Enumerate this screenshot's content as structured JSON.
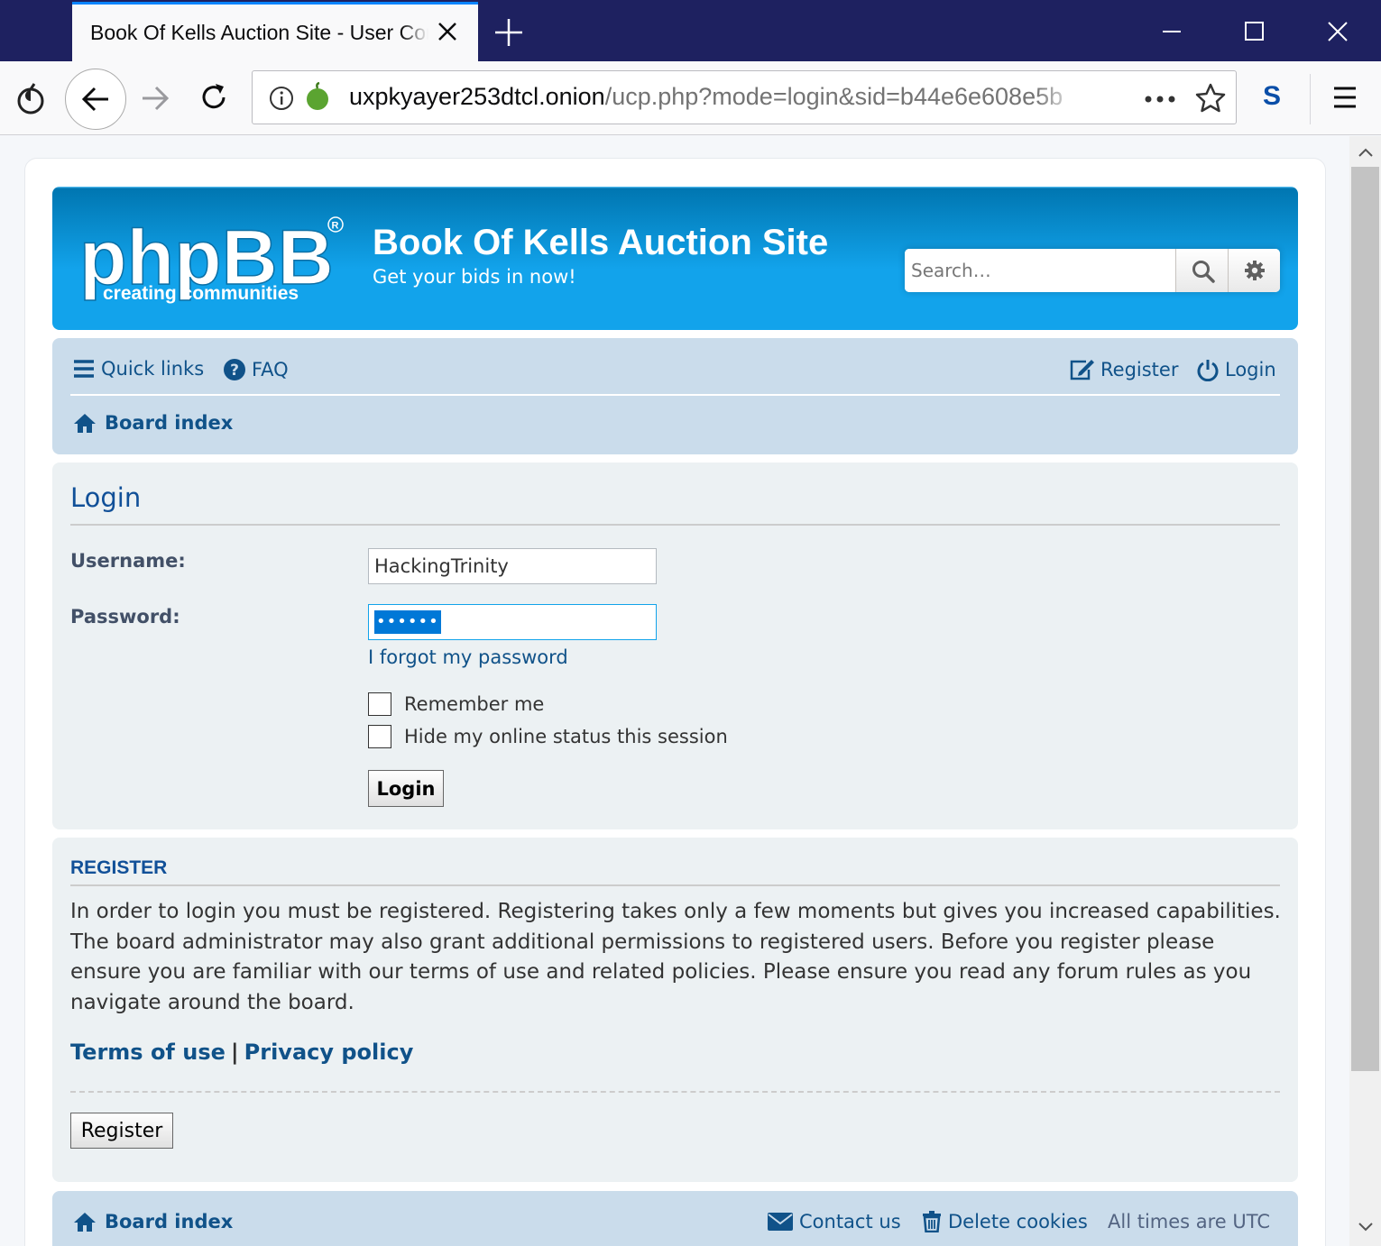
{
  "browser": {
    "tab_title": "Book Of Kells Auction Site - User Control Panel - Login",
    "url_host": "uxpkyayer253dtcl.onion",
    "url_path": "/ucp.php?mode=login&sid=b44e6e608e5b",
    "sync_label": "S"
  },
  "header": {
    "site_title": "Book Of Kells Auction Site",
    "site_desc": "Get your bids in now!",
    "logo_text": "phpBB",
    "logo_tagline": "creating communities",
    "search_placeholder": "Search…"
  },
  "navbar": {
    "quick_links": "Quick links",
    "faq": "FAQ",
    "register": "Register",
    "login": "Login",
    "board_index": "Board index"
  },
  "login": {
    "heading": "Login",
    "username_label": "Username:",
    "username_value": "HackingTrinity",
    "password_label": "Password:",
    "password_value": "••••••",
    "forgot": "I forgot my password",
    "remember": "Remember me",
    "hide_status": "Hide my online status this session",
    "submit": "Login"
  },
  "register": {
    "heading": "REGISTER",
    "text": "In order to login you must be registered. Registering takes only a few moments but gives you increased capabilities. The board administrator may also grant additional permissions to registered users. Before you register please ensure you are familiar with our terms of use and related policies. Please ensure you read any forum rules as you navigate around the board.",
    "terms": "Terms of use",
    "separator": "|",
    "privacy": "Privacy policy",
    "button": "Register"
  },
  "footer": {
    "board_index": "Board index",
    "contact": "Contact us",
    "delete_cookies": "Delete cookies",
    "timezone": "All times are UTC"
  },
  "colors": {
    "titlebar": "#1e2160",
    "header_blue": "#12a3eb",
    "nav_bg": "#cadceb",
    "panel_bg": "#ecf1f3",
    "link": "#105289"
  }
}
